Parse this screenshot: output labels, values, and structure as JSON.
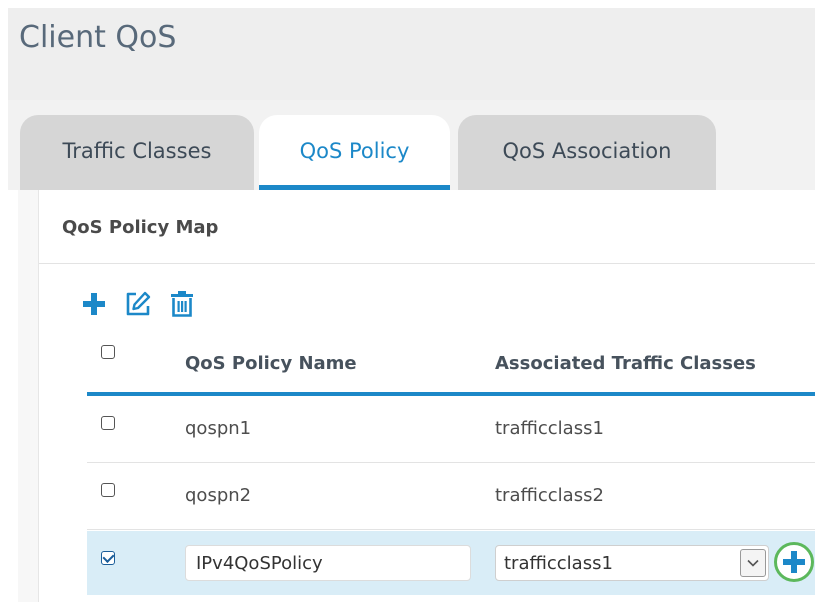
{
  "page": {
    "title": "Client QoS"
  },
  "tabs": [
    {
      "label": "Traffic Classes",
      "active": false
    },
    {
      "label": "QoS Policy",
      "active": true
    },
    {
      "label": "QoS Association",
      "active": false
    }
  ],
  "panel": {
    "title": "QoS Policy Map"
  },
  "toolbar": {
    "icons": [
      "plus-icon",
      "edit-icon",
      "trash-icon"
    ]
  },
  "table": {
    "columns": [
      "QoS Policy Name",
      "Associated Traffic Classes"
    ],
    "rows": [
      {
        "name": "qospn1",
        "traffic_class": "trafficclass1",
        "checked": false
      },
      {
        "name": "qospn2",
        "traffic_class": "trafficclass2",
        "checked": false
      }
    ],
    "edit_row": {
      "name_value": "IPv4QoSPolicy",
      "traffic_class_selected": "trafficclass1",
      "checked": true
    }
  },
  "colors": {
    "accent": "#1c88c8",
    "selected_row": "#d9edf7",
    "add_ring": "#5cb85c"
  }
}
